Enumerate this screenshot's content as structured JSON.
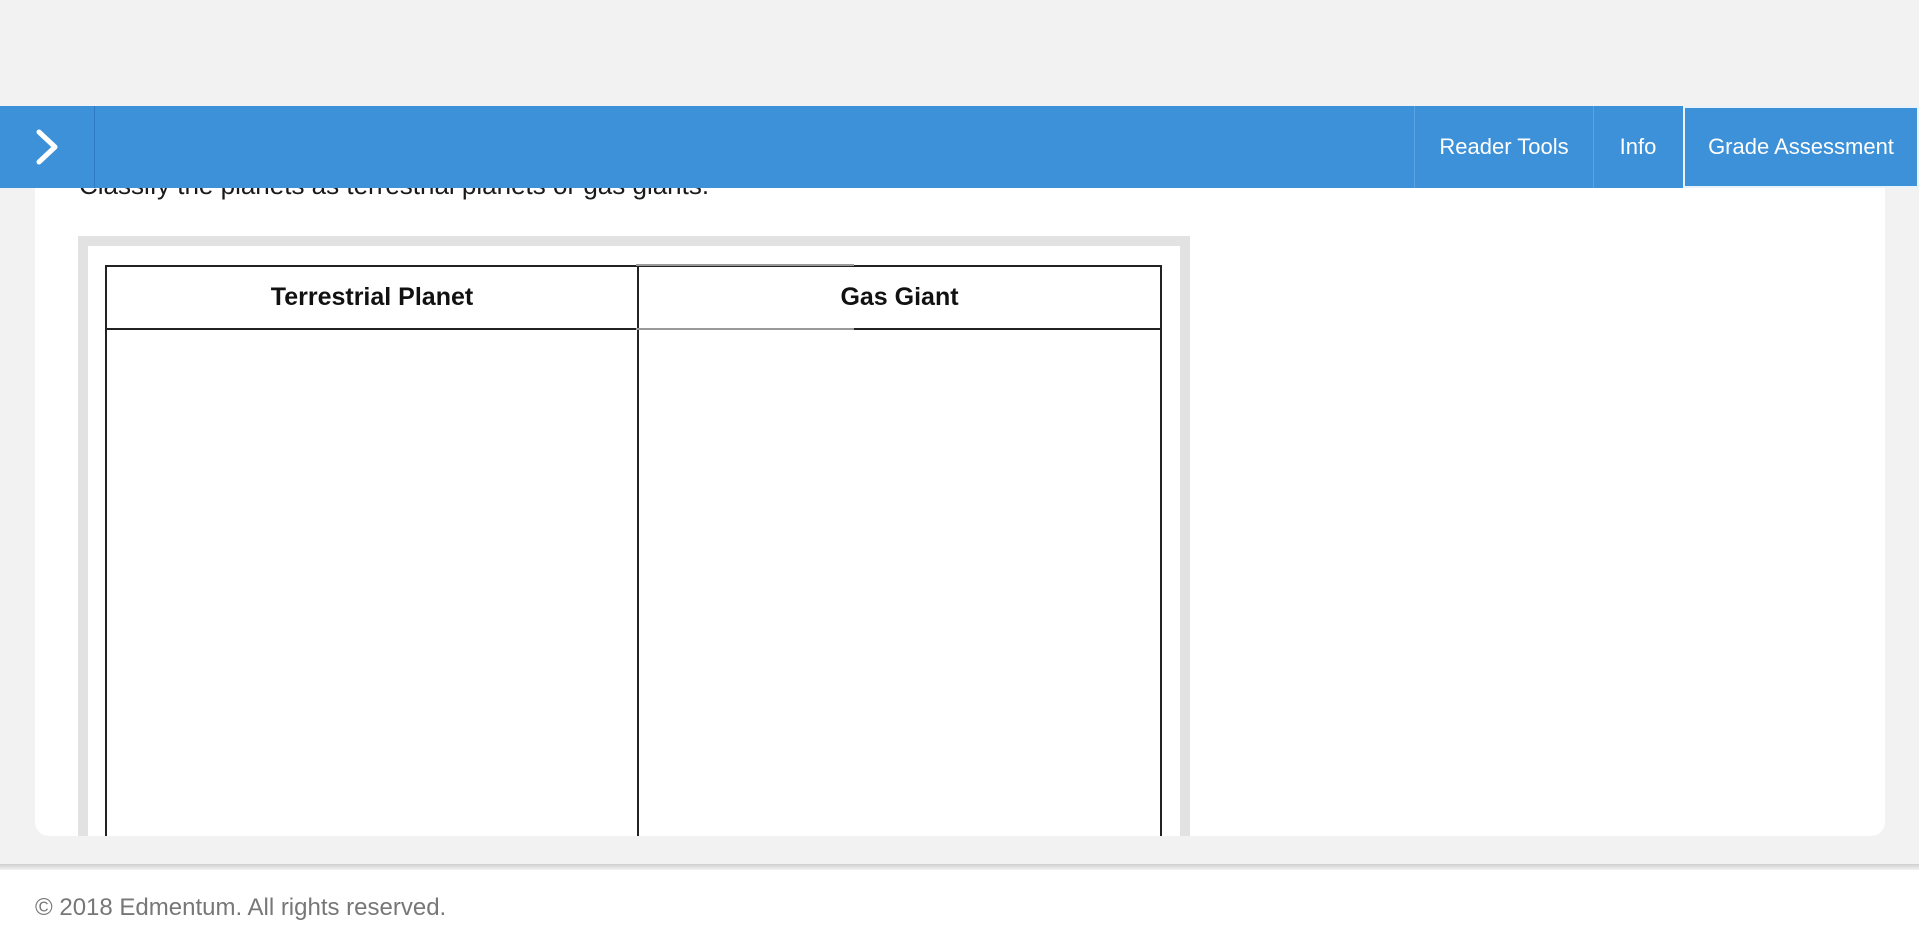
{
  "header": {
    "buttons": {
      "reader_tools": "Reader Tools",
      "info": "Info",
      "grade_assessment": "Grade Assessment"
    },
    "toggle_icon": "chevron-right-icon"
  },
  "question": {
    "prompt": "Classify the planets as terrestrial planets or gas giants."
  },
  "sort_table": {
    "columns": [
      "Terrestrial Planet",
      "Gas Giant"
    ]
  },
  "footer": {
    "copyright": "© 2018 Edmentum. All rights reserved."
  },
  "colors": {
    "header_blue": "#3d91d8",
    "page_background": "#f2f2f2",
    "footer_text": "#777777"
  }
}
